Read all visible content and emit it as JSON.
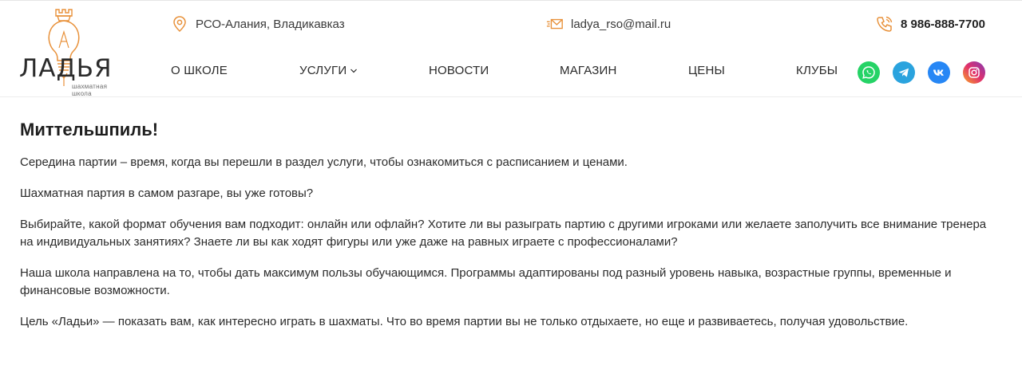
{
  "header": {
    "logo": {
      "text": "ЛАДЬЯ",
      "subtitle": "шахматная школа"
    },
    "contacts": {
      "address": "РСО-Алания, Владикавказ",
      "email": "ladya_rso@mail.ru",
      "phone": "8 986-888-7700"
    },
    "nav": [
      {
        "label": "О ШКОЛЕ"
      },
      {
        "label": "УСЛУГИ"
      },
      {
        "label": "НОВОСТИ"
      },
      {
        "label": "МАГАЗИН"
      },
      {
        "label": "ЦЕНЫ"
      },
      {
        "label": "КЛУБЫ"
      }
    ],
    "social": [
      {
        "icon": "whatsapp-icon",
        "color": "#25D366"
      },
      {
        "icon": "telegram-icon",
        "color": "#2AA3DE"
      },
      {
        "icon": "vk-icon",
        "color": "#2787F5"
      },
      {
        "icon": "instagram-icon",
        "color": "#E1306C"
      }
    ],
    "accent_color": "#E8913A"
  },
  "main": {
    "title": "Миттельшпиль!",
    "paragraphs": [
      "Середина партии – время, когда вы перешли в раздел услуги, чтобы ознакомиться с расписанием и ценами.",
      "Шахматная партия в самом разгаре, вы уже готовы?",
      "Выбирайте, какой формат обучения вам подходит: онлайн или офлайн? Хотите ли вы разыграть партию с другими игроками или желаете заполучить все внимание тренера на индивидуальных занятиях? Знаете ли вы как ходят фигуры или уже даже на равных играете с профессионалами?",
      "Наша школа направлена на то, чтобы дать максимум пользы обучающимся. Программы адаптированы под разный уровень навыка, возрастные группы, временные и финансовые возможности.",
      "Цель «Ладьи» — показать вам, как интересно играть в шахматы. Что во время партии вы не только отдыхаете, но еще и развиваетесь, получая удовольствие."
    ]
  }
}
